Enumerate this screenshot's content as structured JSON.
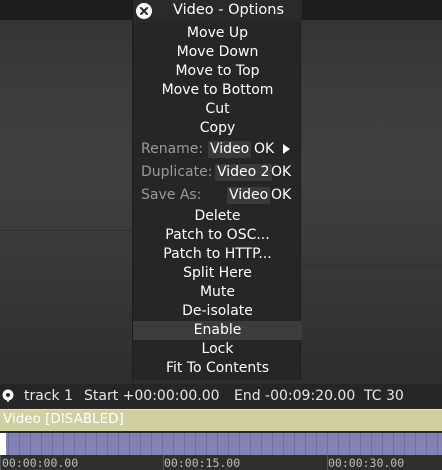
{
  "menu": {
    "title": "Video - Options",
    "items_top": [
      "Move Up",
      "Move Down",
      "Move to Top",
      "Move to Bottom",
      "Cut",
      "Copy"
    ],
    "rename": {
      "label": "Rename:",
      "value": "Video",
      "ok": "OK"
    },
    "duplicate": {
      "label": "Duplicate:",
      "value": "Video 2",
      "ok": "OK"
    },
    "save_as": {
      "label": "Save As:",
      "value": "Video",
      "ok": "OK"
    },
    "items_bottom": [
      "Delete",
      "Patch to OSC...",
      "Patch to HTTP...",
      "Split Here",
      "Mute",
      "De-isolate",
      "Enable",
      "Lock",
      "Fit To Contents"
    ],
    "highlighted": "Enable"
  },
  "track": {
    "name": "track 1",
    "start": "Start +00:00:00.00",
    "end": "End -00:09:20.00",
    "tc": "TC 30"
  },
  "clip": {
    "label": "Video [DISABLED]"
  },
  "ruler": {
    "labels": [
      "00:00:00.00",
      "00:00:15.00",
      "00:00:30.00"
    ]
  },
  "colors": {
    "clip": "#cfcfa2",
    "strip": "#8282b4",
    "menu_bg": "#262626",
    "highlight": "#3c3c3c"
  }
}
